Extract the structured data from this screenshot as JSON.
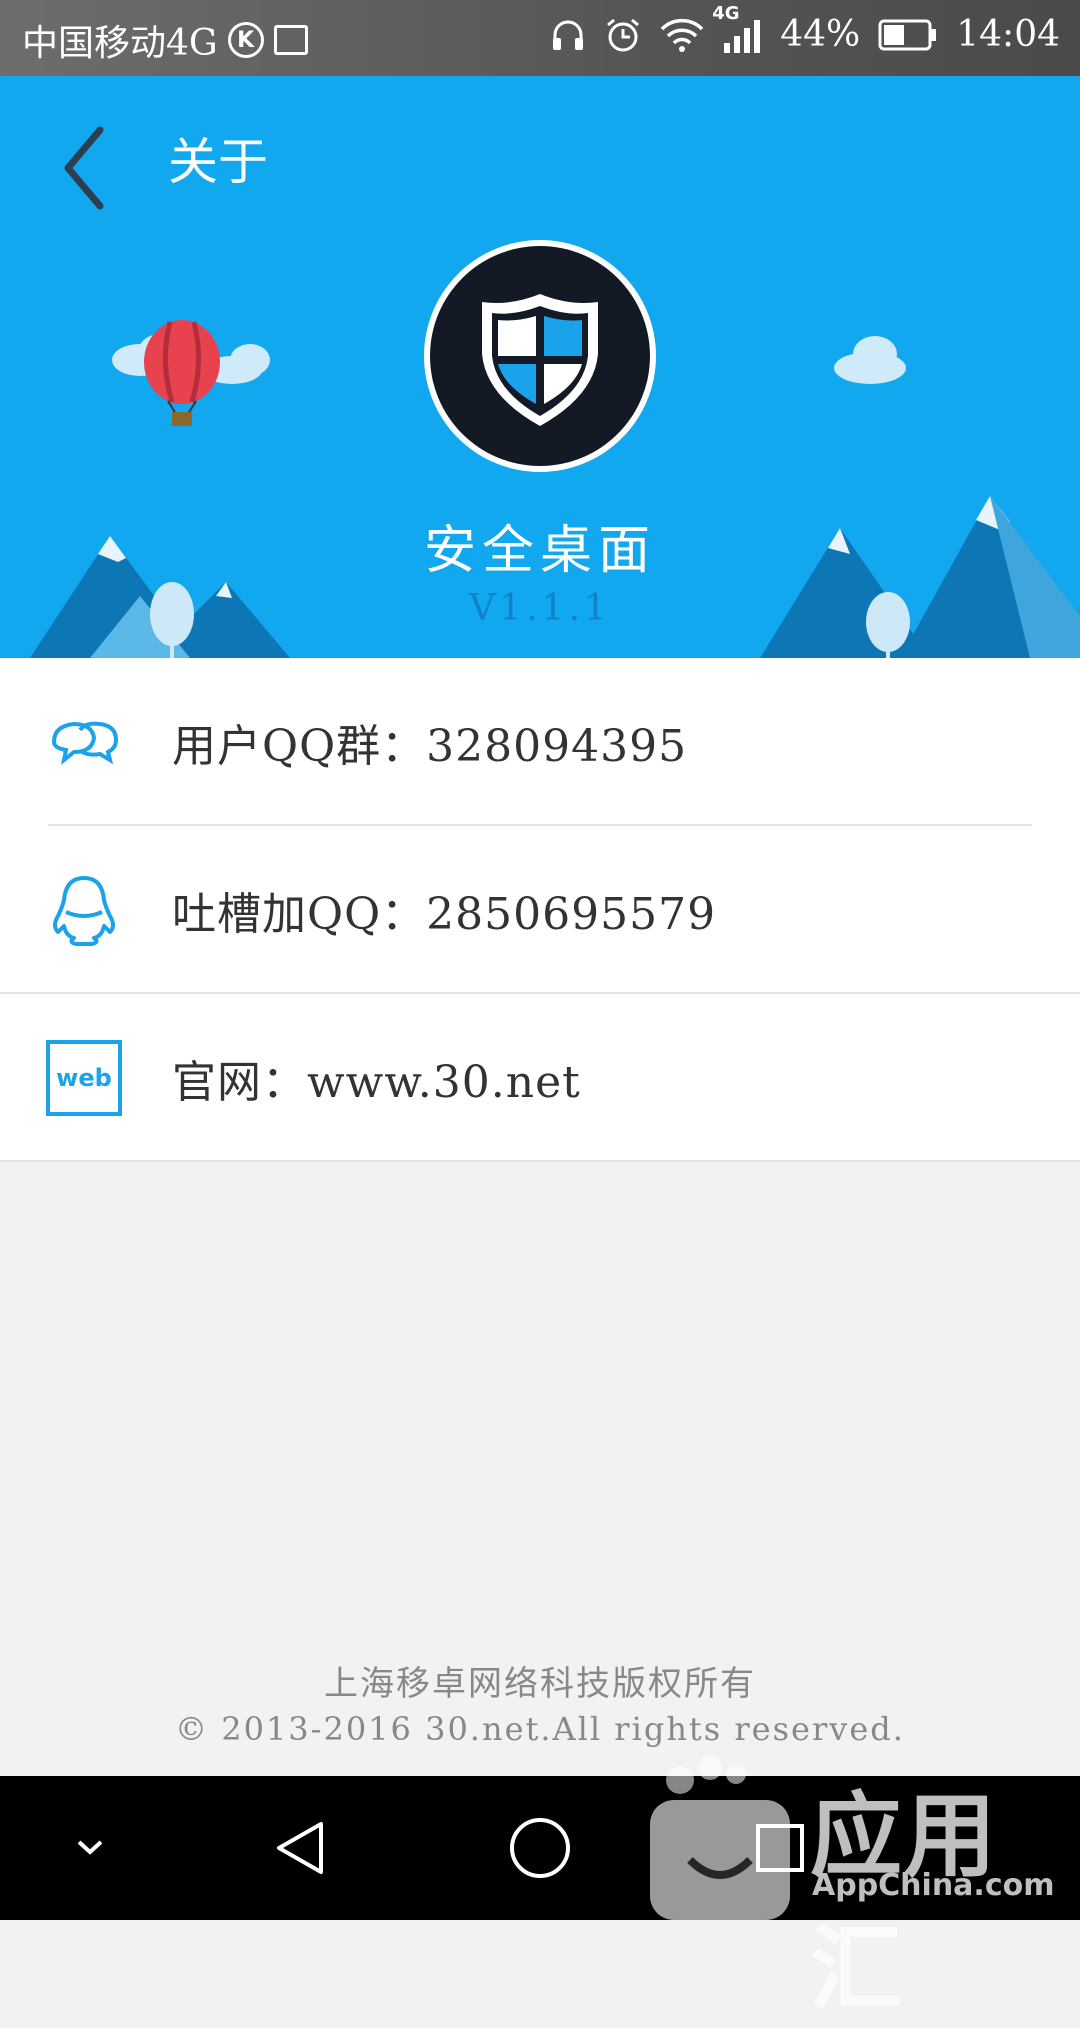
{
  "status_bar": {
    "carrier": "中国移动4G",
    "network": "4G",
    "battery": "44%",
    "time": "14:04",
    "icons": [
      "k-circle-icon",
      "image-icon",
      "headphones-icon",
      "alarm-icon",
      "wifi-icon",
      "signal-icon",
      "battery-icon"
    ]
  },
  "header": {
    "back_icon": "chevron-left-icon",
    "title": "关于",
    "logo_icon": "shield-icon",
    "app_name": "安全桌面",
    "version": "V1.1.1",
    "background_color": "#12a8f0"
  },
  "items": [
    {
      "icon": "chat-bubbles-icon",
      "label": "用户QQ群：328094395"
    },
    {
      "icon": "qq-penguin-icon",
      "label": "吐槽加QQ：2850695579"
    },
    {
      "icon": "web-icon",
      "icon_text": "web",
      "label": "官网：www.30.net"
    }
  ],
  "footer": {
    "company": "上海移卓网络科技版权所有",
    "copyright": "© 2013-2016 30.net.All rights reserved."
  },
  "nav_bar": {
    "icons": [
      "collapse-icon",
      "back-triangle-icon",
      "home-circle-icon",
      "recents-square-icon"
    ]
  },
  "watermark": {
    "brand": "应用汇",
    "site": "AppChina.com"
  }
}
